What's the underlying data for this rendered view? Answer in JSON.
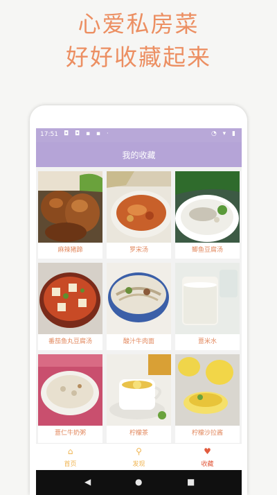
{
  "promo": {
    "line1": "心爱私房菜",
    "line2": "好好收藏起来"
  },
  "status": {
    "time": "17:51",
    "left_icons": "◘ ◘ ▪ ▪ ·",
    "right_icons": "◔ ▾ ▮"
  },
  "appbar": {
    "title": "我的收藏"
  },
  "recipes": [
    {
      "name": "麻辣猪蹄"
    },
    {
      "name": "罗宋汤"
    },
    {
      "name": "鲫鱼豆腐汤"
    },
    {
      "name": "番茄鱼丸豆腐汤"
    },
    {
      "name": "酸汁牛肉面"
    },
    {
      "name": "薏米水"
    },
    {
      "name": "薏仁牛奶粥"
    },
    {
      "name": "柠檬茶"
    },
    {
      "name": "柠檬沙拉酱"
    }
  ],
  "bottom_nav": [
    {
      "label": "首页",
      "icon": "home-icon",
      "glyph": "⌂"
    },
    {
      "label": "发现",
      "icon": "search-icon",
      "glyph": "⚲"
    },
    {
      "label": "收藏",
      "icon": "heart-icon",
      "glyph": "♥"
    }
  ],
  "system_nav": {
    "back": "◀",
    "home": "●",
    "recent": "■"
  },
  "colors": {
    "accent": "#ec8f62",
    "appbar": "#b5a4d7",
    "nav_active": "#e25b3e",
    "nav_inactive": "#f0b552"
  }
}
